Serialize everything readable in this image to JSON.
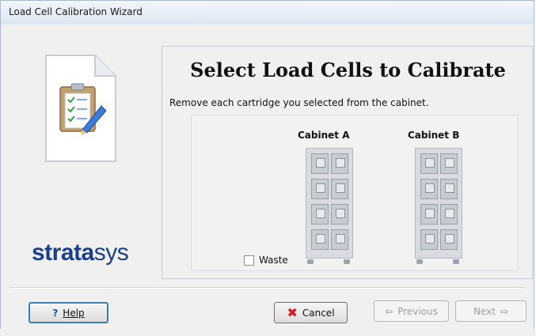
{
  "window": {
    "title": "Load Cell Calibration Wizard"
  },
  "logo": {
    "brand_bold": "strata",
    "brand_regular": "sys"
  },
  "main": {
    "heading": "Select Load Cells to Calibrate",
    "instruction": "Remove each cartridge you selected from the cabinet.",
    "cabinets": [
      {
        "label": "Cabinet A"
      },
      {
        "label": "Cabinet B"
      }
    ],
    "waste": {
      "label": "Waste",
      "checked": false
    }
  },
  "buttons": {
    "help": "Help",
    "cancel": "Cancel",
    "previous": "Previous",
    "next": "Next"
  },
  "icons": {
    "clipboard": "clipboard-document-icon",
    "cancel": "red-x-icon",
    "help": "question-mark-icon",
    "previous": "arrow-left-icon",
    "next": "arrow-right-icon"
  },
  "colors": {
    "brand": "#1b3f87",
    "cancel_x": "#d11a1a",
    "help_border": "#3c7fb1"
  }
}
